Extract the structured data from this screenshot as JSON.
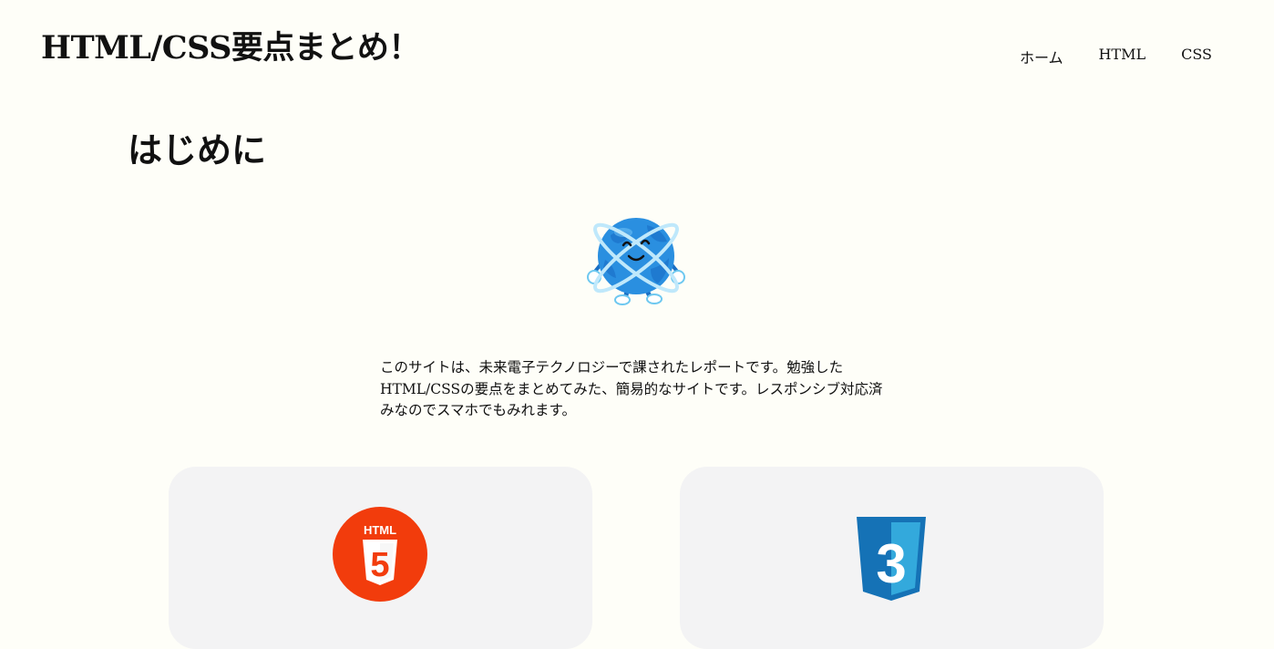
{
  "header": {
    "site_title": "HTML/CSS要点まとめ！",
    "nav": [
      {
        "label": "ホーム"
      },
      {
        "label": "HTML"
      },
      {
        "label": "CSS"
      }
    ]
  },
  "main": {
    "heading": "はじめに",
    "mascot_icon": "earth-mascot-icon",
    "intro": "このサイトは、未来電子テクノロジーで課されたレポートです。勉強したHTML/CSSの要点をまとめてみた、簡易的なサイトです。レスポンシブ対応済みなのでスマホでもみれます。",
    "cards": [
      {
        "icon": "html5-logo-icon",
        "logo_text": "HTML",
        "logo_number": "5",
        "color": "#f23c0c"
      },
      {
        "icon": "css3-logo-icon",
        "logo_number": "3",
        "color": "#1572b6"
      }
    ]
  },
  "colors": {
    "background": "#fefef8",
    "card_background": "#f3f3f4",
    "text": "#111111"
  }
}
